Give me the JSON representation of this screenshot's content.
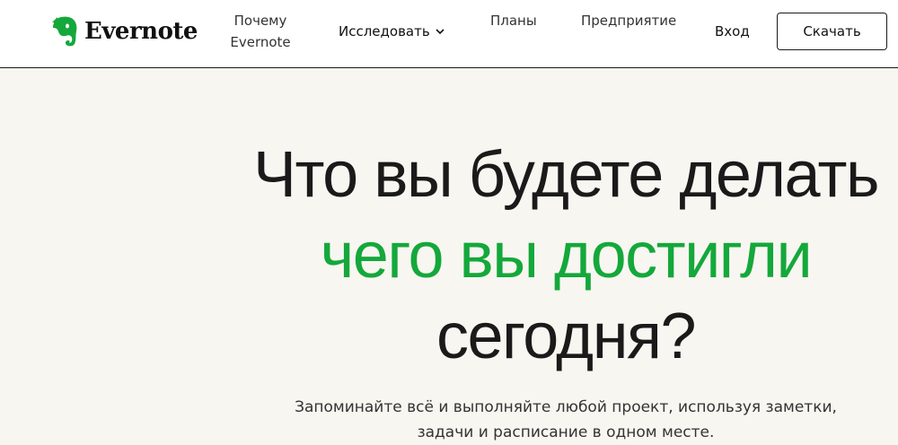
{
  "header": {
    "logo_text": "Evernote",
    "nav": {
      "why_line1": "Почему",
      "why_line2": "Evernote",
      "explore": "Исследовать",
      "plans": "Планы",
      "enterprise": "Предприятие",
      "login": "Вход"
    },
    "download_label": "Скачать"
  },
  "hero": {
    "line1": "Что вы будете делать",
    "line2": "чего вы достигли",
    "line3": "сегодня?",
    "subtitle": "Запоминайте всё и выполняйте любой проект, используя заметки, задачи и расписание в одном месте."
  },
  "colors": {
    "brand_green": "#14a83b",
    "background": "#f8f6f1",
    "header_bg": "#ffffff",
    "text": "#1a1a1a"
  },
  "icons": {
    "logo": "evernote-elephant-icon",
    "explore_caret": "chevron-down-icon"
  }
}
